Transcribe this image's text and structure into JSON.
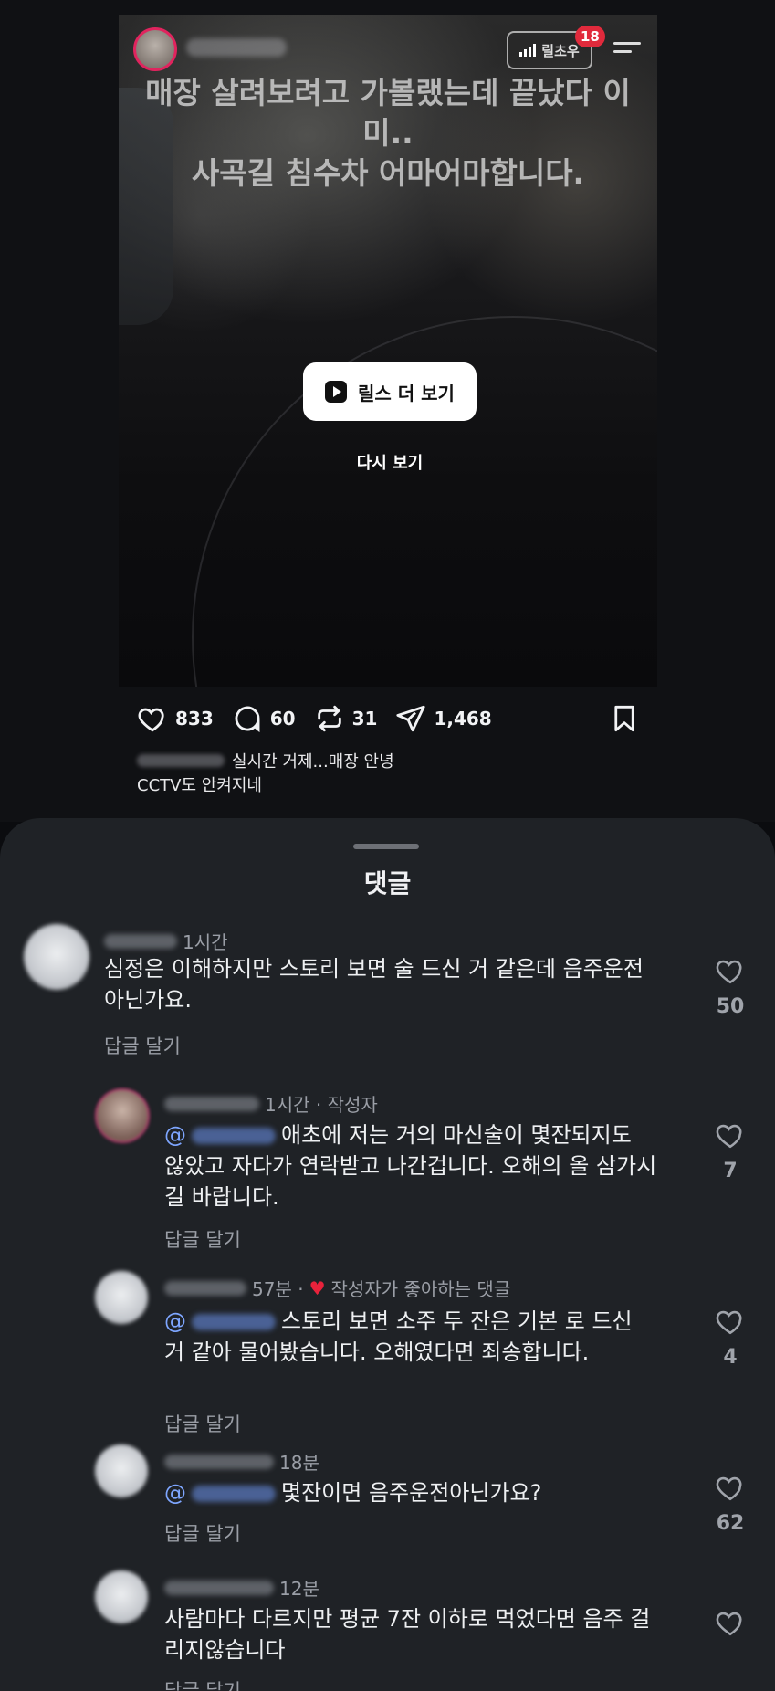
{
  "story": {
    "caption_overlay": "매장 살려보려고 가볼랬는데 끝났다 이미..\n사곡길 침수차 어마어마합니다.",
    "badge": "18",
    "chip_label": "릴초우",
    "reels_button": "릴스 더 보기",
    "replay": "다시 보기"
  },
  "actions": {
    "likes": "833",
    "comments": "60",
    "reposts": "31",
    "shares": "1,468"
  },
  "caption": {
    "line1": "실시간 거제...매장 안녕",
    "line2": "CCTV도 안켜지네"
  },
  "sheet": {
    "title": "댓글",
    "reply_label": "답글 달기"
  },
  "comments": [
    {
      "time": "1시간",
      "tag": "",
      "text": "심정은 이해하지만 스토리 보면 술 드신 거 같은데 음주운전 아닌가요.",
      "likes": "50"
    },
    {
      "time": "1시간 · 작성자",
      "tag": "",
      "mention": "@",
      "text": "애초에 저는 거의 마신술이 몇잔되지도 않았고 자다가 연락받고 나간겁니다. 오해의 올 삼가시길 바랍니다.",
      "likes": "7"
    },
    {
      "time": "57분 ·",
      "tag": "작성자가 좋아하는 댓글",
      "mention": "@",
      "text": "스토리 보면 소주 두 잔은 기본 로 드신 거 같아 물어봤습니다. 오해였다면 죄송합니다.",
      "likes": "4"
    },
    {
      "time": "18분",
      "tag": "",
      "mention": "@",
      "text": "몇잔이면 음주운전아닌가요?",
      "likes": "62"
    },
    {
      "time": "12분",
      "tag": "",
      "text": "사람마다 다르지만 평균 7잔 이하로 먹었다면 음주 걸리지않습니다",
      "likes": ""
    }
  ]
}
